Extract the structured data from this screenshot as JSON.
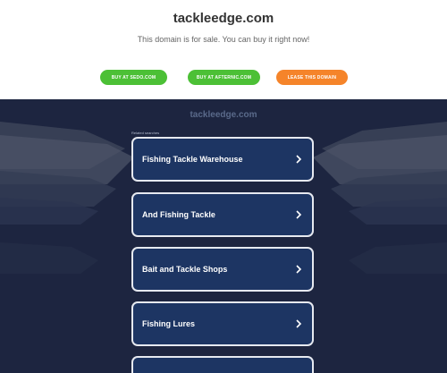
{
  "header": {
    "domain": "tackleedge.com",
    "sale_text": "This domain is for sale. You can buy it right now!"
  },
  "buttons": [
    {
      "label": "BUY AT SEDO.COM",
      "color": "#4cc036"
    },
    {
      "label": "BUY AT AFTERNIC.COM",
      "color": "#4cc036"
    },
    {
      "label": "LEASE THIS DOMAIN",
      "color": "#f5842a"
    }
  ],
  "listing": {
    "brand": "tackleedge.com",
    "related_label": "Related searches",
    "items": [
      {
        "label": "Fishing Tackle Warehouse",
        "icon": "chevron-right-icon"
      },
      {
        "label": "And Fishing Tackle",
        "icon": "chevron-right-icon"
      },
      {
        "label": "Bait and Tackle Shops",
        "icon": "chevron-right-icon"
      },
      {
        "label": "Fishing Lures",
        "icon": "chevron-right-icon"
      },
      {
        "label": "",
        "icon": "chevron-right-icon"
      }
    ]
  }
}
